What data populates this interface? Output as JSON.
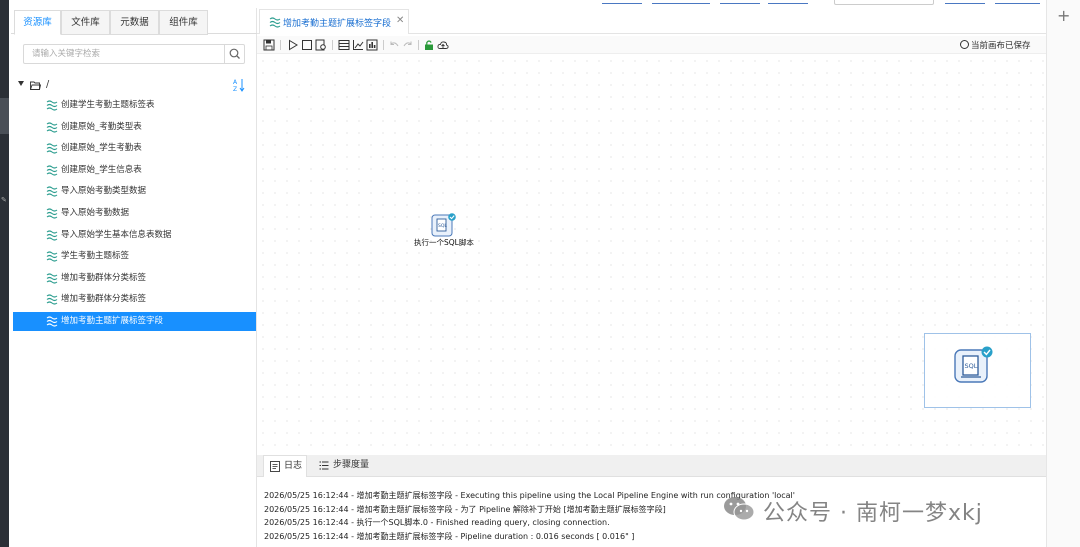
{
  "left_panel": {
    "tabs": [
      "资源库",
      "文件库",
      "元数据",
      "组件库"
    ],
    "active_tab": "资源库",
    "search": {
      "placeholder": "请输入关键字检索",
      "value": ""
    },
    "root": {
      "label": "/"
    },
    "items": [
      {
        "label": "创建学生考勤主题标签表"
      },
      {
        "label": "创建原始_考勤类型表"
      },
      {
        "label": "创建原始_学生考勤表"
      },
      {
        "label": "创建原始_学生信息表"
      },
      {
        "label": "导入原始考勤类型数据"
      },
      {
        "label": "导入原始考勤数据"
      },
      {
        "label": "导入原始学生基本信息表数据"
      },
      {
        "label": "学生考勤主题标签"
      },
      {
        "label": "增加考勤群体分类标签"
      },
      {
        "label": "增加考勤群体分类标签"
      },
      {
        "label": "增加考勤主题扩展标签字段"
      }
    ],
    "selected_index": 10
  },
  "editor": {
    "tab": {
      "label": "增加考勤主题扩展标签字段",
      "close": "✕"
    },
    "saved_status": "当前画布已保存",
    "toolbar_icons": [
      "save-icon",
      "run-icon",
      "stop-icon",
      "preview-icon",
      "grid-icon",
      "chart-icon",
      "metrics-icon",
      "undo-icon",
      "redo-icon",
      "lock-icon",
      "upload-icon"
    ],
    "step": {
      "label": "执行一个SQL脚本",
      "icon": "sql-script-icon"
    },
    "minimap_icon_text": "SQL"
  },
  "bottom_panel": {
    "tabs": [
      {
        "label": "日志",
        "icon": "log-icon"
      },
      {
        "label": "步骤度量",
        "icon": "metrics-list-icon"
      }
    ],
    "active_tab": "日志",
    "log_lines": [
      "2026/05/25 16:12:44 - 增加考勤主题扩展标签字段 - Executing this pipeline using the Local Pipeline Engine with run configuration 'local'",
      "2026/05/25 16:12:44 - 增加考勤主题扩展标签字段 - 为了 Pipeline 解除补丁开始 [增加考勤主题扩展标签字段]",
      "2026/05/25 16:12:44 - 执行一个SQL脚本.0 - Finished reading query, closing connection.",
      "2026/05/25 16:12:44 - 增加考勤主题扩展标签字段 - Pipeline duration : 0.016 seconds [  0.016\" ]"
    ]
  },
  "right_strip": {
    "plus": "+"
  },
  "watermark": {
    "text": "公众号 · 南柯一梦xkj"
  },
  "colors": {
    "accent": "#1890ff",
    "selected_bg": "#1890ff",
    "tab_text": "#1a6fd1",
    "canvas_dot": "#d6d6d6"
  }
}
